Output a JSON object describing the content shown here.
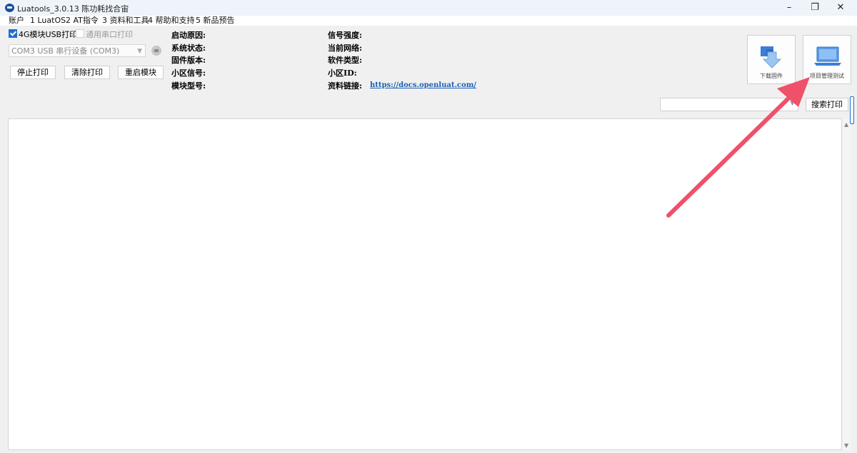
{
  "window": {
    "title": "Luatools_3.0.13 陈功耗找合宙",
    "controls": {
      "minimize": "–",
      "maximize": "❐",
      "close": "✕"
    }
  },
  "menu": [
    "账户",
    "1 LuatOS",
    "2 AT指令",
    "3 资料和工具",
    "4 帮助和支持",
    "5 新品预告"
  ],
  "options": {
    "usb_print": {
      "label": "4G模块USB打印",
      "checked": true
    },
    "uart_print": {
      "label": "通用串口打印",
      "checked": false
    }
  },
  "port": {
    "value": "COM3 USB 串行设备 (COM3)"
  },
  "buttons": {
    "stop_print": "停止打印",
    "clear_print": "清除打印",
    "restart_module": "重启模块"
  },
  "info": {
    "boot_reason": "启动原因:",
    "system_status": "系统状态:",
    "firmware_version": "固件版本:",
    "cell_signal": "小区信号:",
    "module_model": "模块型号:",
    "signal_strength": "信号强度:",
    "current_network": "当前网络:",
    "software_type": "软件类型:",
    "cell_id": "小区ID:",
    "doc_link_label": "资料链接:",
    "doc_link_url": "https://docs.openluat.com/"
  },
  "tools": {
    "download_firmware": "下载固件",
    "project_manage": "项目管理测试"
  },
  "search": {
    "value": "",
    "button": "搜索打印"
  },
  "colors": {
    "accent": "#1e6fd0",
    "annotation_arrow": "#f0506a",
    "link": "#1a5fb4"
  },
  "icons": {
    "download": "download-firmware-icon",
    "project": "laptop-icon"
  }
}
